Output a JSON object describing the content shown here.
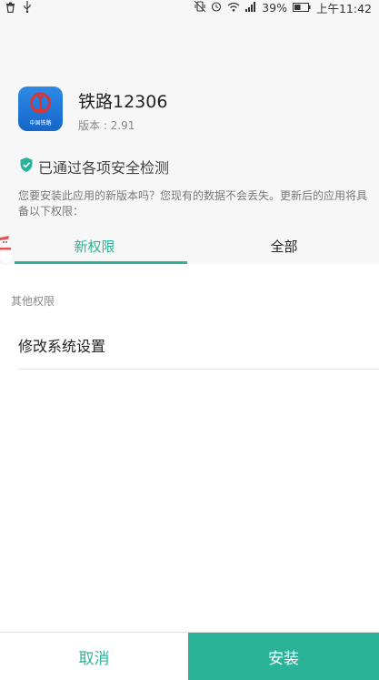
{
  "status_bar": {
    "battery_percent": "39%",
    "time": "上午11:42",
    "left_icons": [
      "trash-icon",
      "usb-icon"
    ],
    "right_icons": [
      "vibrate-icon",
      "alarm-icon",
      "wifi-icon",
      "signal-icon",
      "battery-icon"
    ]
  },
  "app": {
    "name": "铁路12306",
    "version": "版本 : 2.91",
    "icon_label": "中国铁路"
  },
  "security": {
    "text": "已通过各项安全检测",
    "icon": "shield-check-icon",
    "color": "#2bb39a"
  },
  "description": "您要安装此应用的新版本吗？您现有的数据不会丢失。更新后的应用将具备以下权限：",
  "tabs": [
    {
      "label": "新权限",
      "active": true
    },
    {
      "label": "全部",
      "active": false
    }
  ],
  "permissions": {
    "section_label": "其他权限",
    "items": [
      "修改系统设置"
    ]
  },
  "buttons": {
    "cancel": "取消",
    "install": "安装"
  },
  "colors": {
    "accent": "#2bb39a",
    "app_icon": "#1e73d8"
  }
}
